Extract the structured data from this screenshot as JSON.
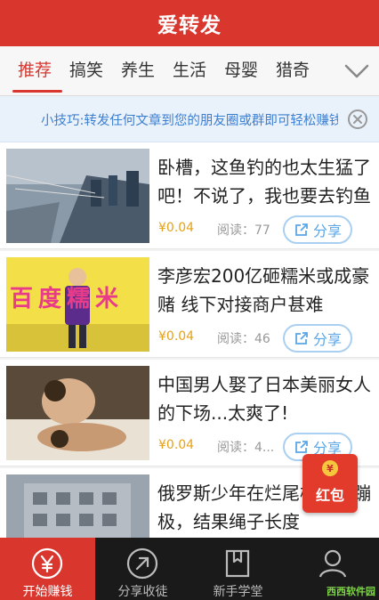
{
  "app": {
    "title": "爱转发"
  },
  "tabs": [
    "推荐",
    "搞笑",
    "养生",
    "生活",
    "母婴",
    "猎奇"
  ],
  "active_tab": "推荐",
  "tip": {
    "text": "小技巧:转发任何文章到您的朋友圈或群即可轻松赚钱"
  },
  "feed": [
    {
      "title": "卧槽，这鱼钓的也太生猛了吧！不说了，我也要去钓鱼了",
      "reward": "¥0.04",
      "reads_label": "阅读：",
      "reads": "77",
      "share_label": "分享"
    },
    {
      "title": "李彦宏200亿砸糯米或成豪赌 线下对接商户甚难",
      "reward": "¥0.04",
      "reads_label": "阅读：",
      "reads": "46",
      "share_label": "分享"
    },
    {
      "title": "中国男人娶了日本美丽女人的下场...太爽了!",
      "reward": "¥0.04",
      "reads_label": "阅读：",
      "reads": "4...",
      "share_label": "分享"
    },
    {
      "title": "俄罗斯少年在烂尾楼顶玩蹦极，结果绳子长度",
      "reward": "",
      "reads_label": "",
      "reads": "",
      "share_label": ""
    }
  ],
  "thumb_texts": {
    "item2": "百度糯米"
  },
  "redpack": {
    "label": "红包",
    "coin": "¥"
  },
  "bottom_nav": [
    {
      "label": "开始赚钱",
      "icon": "yen-circle-icon"
    },
    {
      "label": "分享收徒",
      "icon": "share-arrow-circle-icon"
    },
    {
      "label": "新手学堂",
      "icon": "book-icon"
    },
    {
      "label": "",
      "icon": "user-icon"
    }
  ],
  "watermark": "西西软件园",
  "colors": {
    "brand": "#d9362e",
    "tip": "#3d7fd1",
    "reward": "#e6a21a",
    "share": "#5aa6e8"
  }
}
